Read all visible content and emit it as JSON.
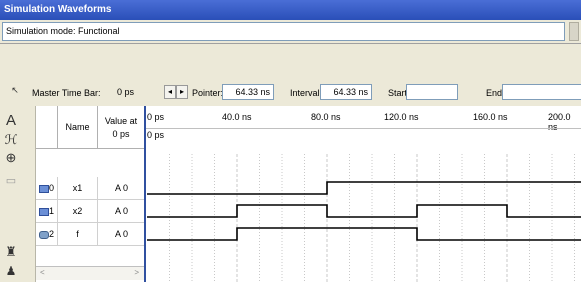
{
  "window": {
    "title": "Simulation Waveforms"
  },
  "mode": {
    "text": "Simulation mode: Functional"
  },
  "toolbar": {
    "master_label": "Master Time Bar:",
    "master_value": "0 ps",
    "pointer_label": "Pointer:",
    "pointer_value": "64.33 ns",
    "interval_label": "Interval:",
    "interval_value": "64.33 ns",
    "start_label": "Start:",
    "start_value": "",
    "end_label": "End:",
    "end_value": "",
    "prev_glyph": "◂",
    "next_glyph": "▸"
  },
  "tools": [
    {
      "icon": "arrow-pointer-icon",
      "glyph": "↖"
    },
    {
      "icon": "text-tool-icon",
      "glyph": "A"
    },
    {
      "icon": "waveform-editor-icon",
      "glyph": "ℋ"
    },
    {
      "icon": "zoom-icon",
      "glyph": "⊕"
    },
    {
      "icon": "copy-icon",
      "glyph": "▭"
    },
    {
      "icon": "find-icon",
      "glyph": "♜"
    },
    {
      "icon": "extra-tool-icon",
      "glyph": "♟"
    }
  ],
  "columns": {
    "name": "Name",
    "value": "Value at\n0 ps"
  },
  "signals": [
    {
      "index": "0",
      "name": "x1",
      "value": "A 0",
      "icon": "input-pin-icon"
    },
    {
      "index": "1",
      "name": "x2",
      "value": "A 0",
      "icon": "input-pin-icon"
    },
    {
      "index": "2",
      "name": "f",
      "value": "A 0",
      "icon": "output-pin-icon"
    }
  ],
  "timeline": {
    "ticks": [
      "0 ps",
      "40.0 ns",
      "80.0 ns",
      "120.0 ns",
      "160.0 ns",
      "200.0 ns"
    ],
    "cursor_label": "0 ps"
  },
  "waveforms": {
    "time_max_ns": 200,
    "x1": {
      "transitions_ns": [
        80
      ],
      "initial": 0
    },
    "x2": {
      "transitions_ns": [
        40,
        80,
        120,
        160
      ],
      "initial": 0
    },
    "f": {
      "transitions_ns": [
        40,
        120
      ],
      "initial": 0
    }
  },
  "scroll": {
    "left_glyph": "<",
    "right_glyph": ">"
  },
  "colors": {
    "titlebar": "#2a4fb8",
    "divider": "#3050a0",
    "wave": "#000000",
    "grid": "#c8c8c8"
  }
}
